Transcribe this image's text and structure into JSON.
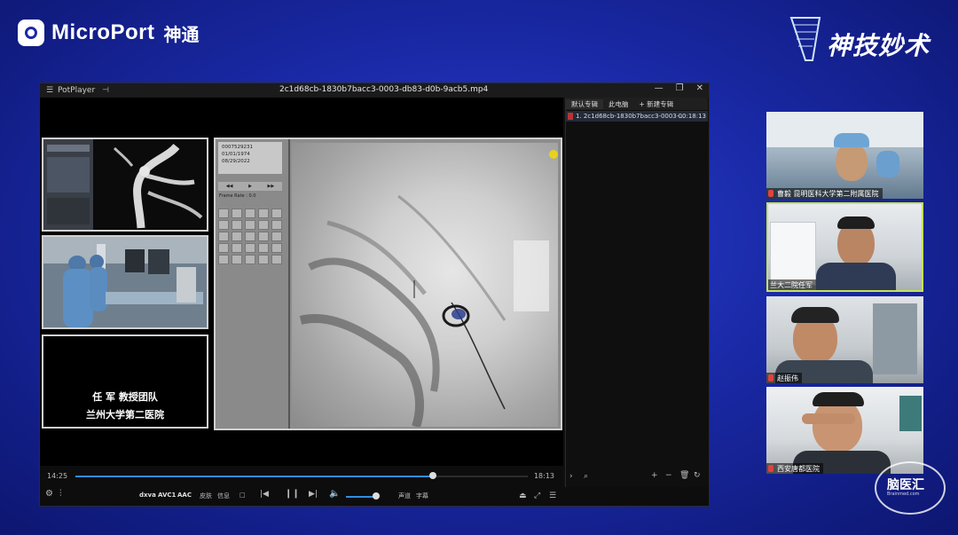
{
  "brand": {
    "name": "MicroPort",
    "cn": "神通"
  },
  "logo_right": {
    "text": "神技妙术"
  },
  "player": {
    "app_name": "PotPlayer",
    "file_title": "2c1d68cb-1830b7bacc3-0003-db83-d0b-9acb5.mp4",
    "current_time": "14:25",
    "duration": "18:13",
    "progress": 0.79,
    "volume": 0.75,
    "codec_labels": [
      "dxva",
      "AVC1",
      "AAC"
    ],
    "mini_buttons": [
      "皮肤",
      "信息"
    ],
    "audio_label": "声道",
    "subtitle_label": "字幕",
    "video_overlay": {
      "team_line1": "任 军 教授团队",
      "team_line2": "兰州大学第二医院",
      "ws_info": [
        "0007529231",
        "01/01/1974",
        "",
        "08/29/2022"
      ],
      "frame_label": "Frame Rate : 0.0"
    }
  },
  "playlist": {
    "tabs": [
      "默认专辑",
      "此电脑",
      "+ 新建专辑"
    ],
    "items": [
      {
        "name": "1. 2c1d68cb-1830b7bacc3-0003-...",
        "time": "00:18:13"
      }
    ]
  },
  "participants": [
    {
      "name": "曹毅 昆明医科大学第二附属医院"
    },
    {
      "name": "兰大二院任军"
    },
    {
      "name": "赵振伟"
    },
    {
      "name": "西安唐都医院"
    }
  ],
  "watermark": {
    "text": "脑医汇",
    "sub": "Brainmed.com"
  }
}
